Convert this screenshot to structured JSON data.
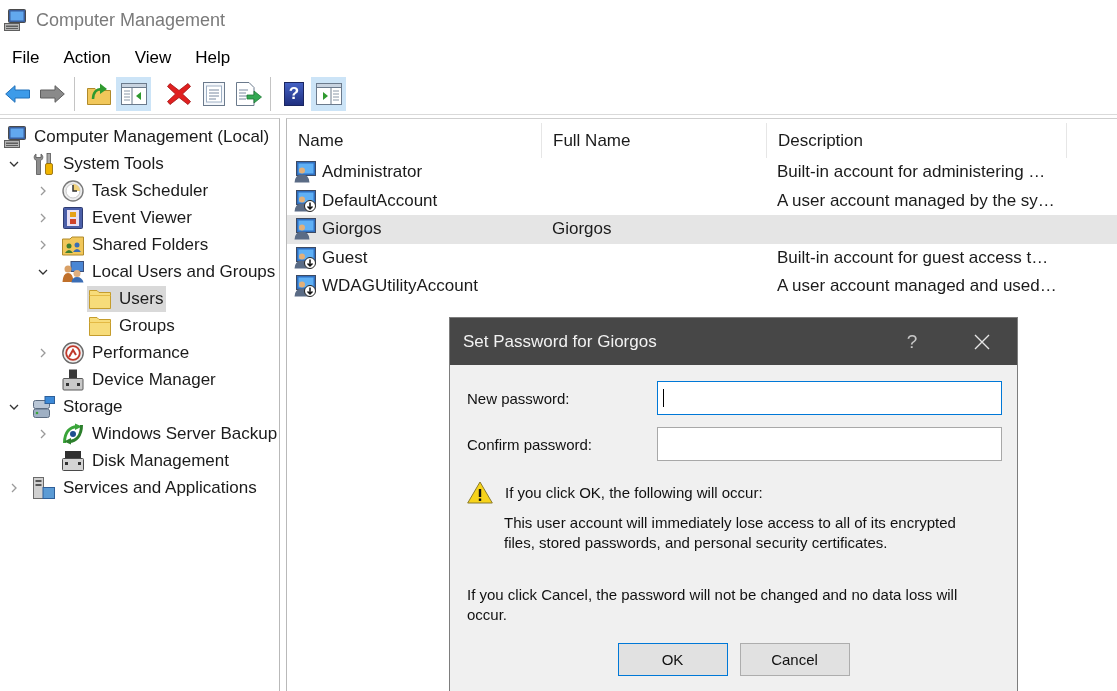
{
  "window": {
    "title": "Computer Management"
  },
  "menu": [
    {
      "label": "File"
    },
    {
      "label": "Action"
    },
    {
      "label": "View"
    },
    {
      "label": "Help"
    }
  ],
  "toolbar": [
    {
      "divider": false,
      "items": [
        {
          "kind": "back",
          "pressed": false
        },
        {
          "kind": "forward",
          "pressed": false
        }
      ]
    },
    {
      "divider": true,
      "items": [
        {
          "kind": "up",
          "pressed": false
        },
        {
          "kind": "console-tree",
          "pressed": true
        }
      ]
    },
    {
      "divider": false,
      "items": [
        {
          "kind": "delete",
          "pressed": false
        },
        {
          "kind": "properties",
          "pressed": false
        },
        {
          "kind": "export",
          "pressed": false
        }
      ]
    },
    {
      "divider": true,
      "items": [
        {
          "kind": "help",
          "pressed": false,
          "glyph": "?"
        },
        {
          "kind": "action-pane",
          "pressed": true
        }
      ]
    }
  ],
  "tree": [
    {
      "label": "Computer Management (Local)",
      "kind": "computer",
      "selected": false,
      "children": [
        {
          "label": "System Tools",
          "kind": "tools",
          "expanded": true,
          "selected": false,
          "children": [
            {
              "label": "Task Scheduler",
              "kind": "clock",
              "expanded": false,
              "selected": false
            },
            {
              "label": "Event Viewer",
              "kind": "event-log",
              "expanded": false,
              "selected": false
            },
            {
              "label": "Shared Folders",
              "kind": "shared-folder",
              "expanded": false,
              "selected": false
            },
            {
              "label": "Local Users and Groups",
              "kind": "users",
              "expanded": true,
              "selected": false,
              "children": [
                {
                  "label": "Users",
                  "kind": "folder",
                  "selected": true
                },
                {
                  "label": "Groups",
                  "kind": "folder",
                  "selected": false
                }
              ]
            },
            {
              "label": "Performance",
              "kind": "gauge",
              "expanded": false,
              "selected": false
            },
            {
              "label": "Device Manager",
              "kind": "device",
              "selected": false
            }
          ]
        },
        {
          "label": "Storage",
          "kind": "storage",
          "expanded": true,
          "selected": false,
          "children": [
            {
              "label": "Windows Server Backup",
              "kind": "backup",
              "expanded": false,
              "selected": false
            },
            {
              "label": "Disk Management",
              "kind": "disk",
              "selected": false
            }
          ]
        },
        {
          "label": "Services and Applications",
          "kind": "services",
          "expanded": false,
          "selected": false
        }
      ]
    }
  ],
  "table": {
    "columns": [
      "Name",
      "Full Name",
      "Description"
    ],
    "rows": [
      {
        "name": "Administrator",
        "description": "Built-in account for administering …",
        "disabled": false,
        "selected": false
      },
      {
        "name": "DefaultAccount",
        "description": "A user account managed by the sy…",
        "disabled": true,
        "selected": false
      },
      {
        "name": "Giorgos",
        "full_name": "Giorgos",
        "disabled": false,
        "selected": true
      },
      {
        "name": "Guest",
        "description": "Built-in account for guest access t…",
        "disabled": true,
        "selected": false
      },
      {
        "name": "WDAGUtilityAccount",
        "description": "A user account managed and used…",
        "disabled": true,
        "selected": false
      }
    ]
  },
  "dialog": {
    "title": "Set Password for Giorgos",
    "help_button": "?",
    "fields": [
      {
        "label": "New password:",
        "focused": true
      },
      {
        "label": "Confirm password:",
        "focused": false
      }
    ],
    "warning": {
      "heading": "If you click OK, the following will occur:",
      "detail": "This user account will immediately lose access to all of its encrypted files, stored passwords, and personal security certificates."
    },
    "note": "If you click Cancel, the password will not be changed and no data loss will occur.",
    "buttons": [
      {
        "label": "OK",
        "default": true
      },
      {
        "label": "Cancel",
        "default": false
      }
    ]
  }
}
